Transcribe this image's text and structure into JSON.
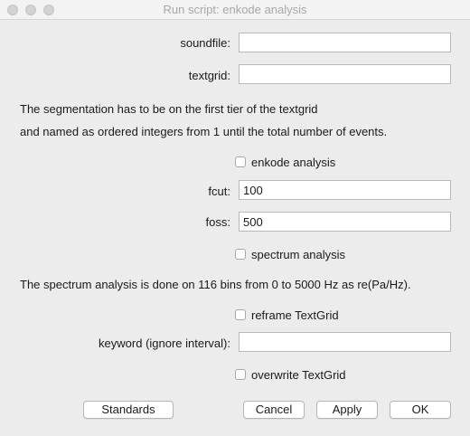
{
  "window": {
    "title": "Run script: enkode analysis"
  },
  "fields": {
    "soundfile": {
      "label": "soundfile:",
      "value": ""
    },
    "textgrid": {
      "label": "textgrid:",
      "value": ""
    },
    "fcut": {
      "label": "fcut:",
      "value": "100"
    },
    "foss": {
      "label": "foss:",
      "value": "500"
    },
    "keyword": {
      "label": "keyword (ignore interval):",
      "value": ""
    }
  },
  "notes": {
    "segmentation_1": "The segmentation has to be on the first tier of the textgrid",
    "segmentation_2": "and named as ordered integers from 1 until the total number of events.",
    "spectrum": "The spectrum analysis is done on 116 bins from 0 to 5000 Hz as re(Pa/Hz)."
  },
  "checkboxes": {
    "enkode": {
      "label": "enkode analysis",
      "checked": false
    },
    "spectrum": {
      "label": "spectrum analysis",
      "checked": false
    },
    "reframe": {
      "label": "reframe TextGrid",
      "checked": false
    },
    "overwrite": {
      "label": "overwrite TextGrid",
      "checked": false
    }
  },
  "buttons": {
    "standards": "Standards",
    "cancel": "Cancel",
    "apply": "Apply",
    "ok": "OK"
  }
}
